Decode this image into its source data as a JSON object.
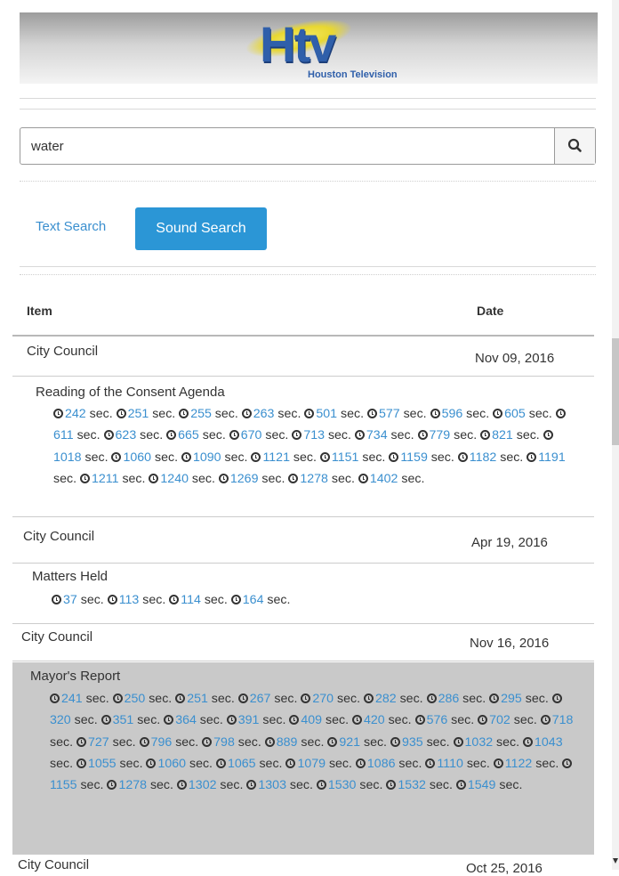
{
  "logo": {
    "letters": "Htv",
    "subtitle": "Houston Television"
  },
  "search": {
    "value": "water",
    "placeholder": ""
  },
  "icons": {
    "search": "magnifying-glass-icon",
    "clock": "clock-icon"
  },
  "mode_tabs": {
    "text_search": "Text Search",
    "sound_search": "Sound Search"
  },
  "table": {
    "header_item": "Item",
    "header_date": "Date"
  },
  "colors": {
    "accent": "#2b96d6",
    "link": "#3a8fcf",
    "highlight_row": "#c9c9c9"
  },
  "groups": [
    {
      "title": "City Council",
      "date": "Nov 09, 2016",
      "entries": [
        {
          "title": "Reading of the Consent Agenda",
          "times": [
            "242",
            "251",
            "255",
            "263",
            "501",
            "577",
            "596",
            "605",
            "611",
            "623",
            "665",
            "670",
            "713",
            "734",
            "779",
            "821",
            "1018",
            "1060",
            "1090",
            "1121",
            "1151",
            "1159",
            "1182",
            "1191",
            "1211",
            "1240",
            "1269",
            "1278",
            "1402"
          ]
        }
      ]
    },
    {
      "title": "City Council",
      "date": "Apr 19, 2016",
      "entries": [
        {
          "title": "Matters Held",
          "times": [
            "37",
            "113",
            "114",
            "164"
          ]
        }
      ]
    },
    {
      "title": "City Council",
      "date": "Nov 16, 2016",
      "entries": [
        {
          "title": "Mayor's Report",
          "times": [
            "241",
            "250",
            "251",
            "267",
            "270",
            "282",
            "286",
            "295",
            "320",
            "351",
            "364",
            "391",
            "409",
            "420",
            "576",
            "702",
            "718",
            "727",
            "796",
            "798",
            "889",
            "921",
            "935",
            "1032",
            "1043",
            "1055",
            "1060",
            "1065",
            "1079",
            "1086",
            "1110",
            "1122",
            "1155",
            "1278",
            "1302",
            "1303",
            "1530",
            "1532",
            "1549"
          ]
        }
      ]
    },
    {
      "title": "City Council",
      "date": "Oct 25, 2016",
      "entries": []
    }
  ],
  "unit_label": "sec."
}
